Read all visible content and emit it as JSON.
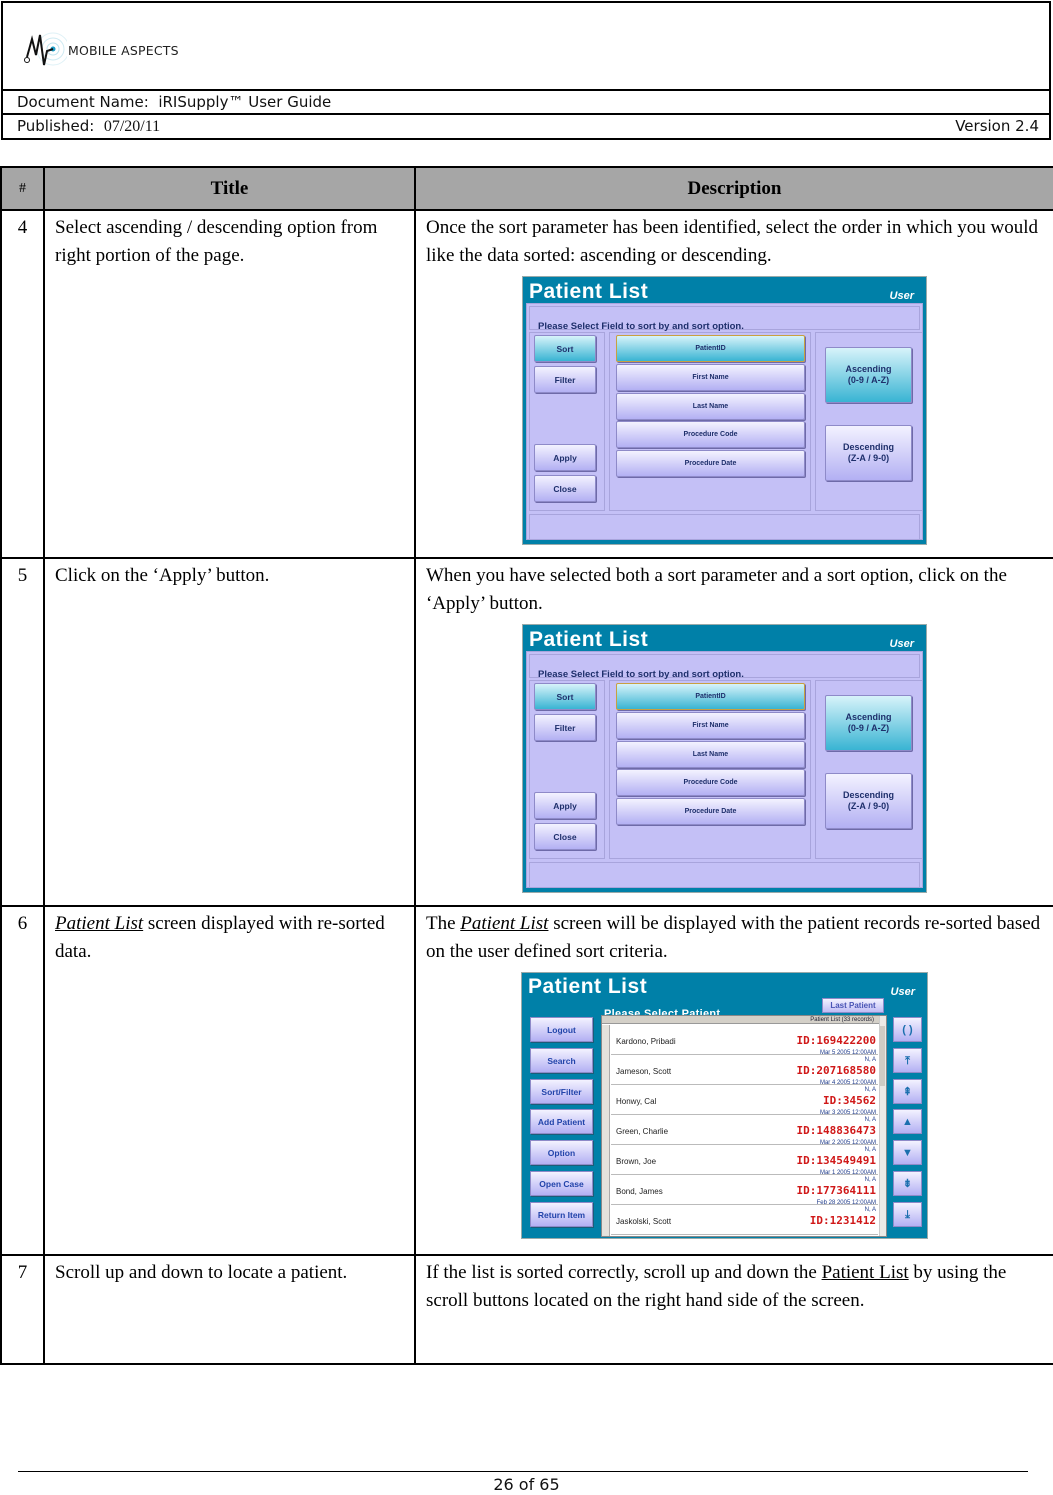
{
  "header": {
    "logo_text": "MOBILE ASPECTS",
    "doc_name_label": "Document Name:",
    "doc_name": "iRISupply™ User Guide",
    "published_label": "Published:",
    "published_date": "07/20/11",
    "version": "Version 2.4"
  },
  "table": {
    "headers": {
      "num": "#",
      "title": "Title",
      "description": "Description"
    },
    "rows": [
      {
        "num": "4",
        "title": "Select ascending / descending option from right portion of the page.",
        "description": "Once the sort parameter has been identified, select the order in which you would like the data sorted: ascending or descending."
      },
      {
        "num": "5",
        "title": "Click on the ‘Apply’ button.",
        "description": "When you have selected both a sort parameter and a sort option, click on the ‘Apply’ button."
      },
      {
        "num": "6",
        "title_link": "Patient List",
        "title_rest": " screen displayed with re-sorted data.",
        "description_pre": "The ",
        "description_link": "Patient List",
        "description_post": " screen will be displayed with the patient records re-sorted based on the user defined sort criteria."
      },
      {
        "num": "7",
        "title": "Scroll up and down to locate a patient.",
        "description_pre": "If the list is sorted correctly, scroll up and down the ",
        "description_link": "Patient List",
        "description_post": " by using the scroll buttons located on the right hand side of the screen."
      }
    ]
  },
  "sort_screen": {
    "title": "Patient List",
    "user": "User",
    "prompt": "Please Select Field to sort by and sort option.",
    "left_buttons": [
      "Sort",
      "Filter",
      "Apply",
      "Close"
    ],
    "fields": [
      "PatientID",
      "First Name",
      "Last Name",
      "Procedure Code",
      "Procedure Date"
    ],
    "selected_field": "PatientID",
    "ascending_label": "Ascending",
    "ascending_sub": "(0-9 / A-Z)",
    "descending_label": "Descending",
    "descending_sub": "(Z-A / 9-0)",
    "selected_order": "Ascending"
  },
  "patient_screen": {
    "title": "Patient List",
    "user": "User",
    "subtitle": "Please Select Patient",
    "last_patient_label": "Last Patient",
    "list_header": "Patient List (33 records)",
    "nav_buttons": [
      "Logout",
      "Search",
      "Sort/Filter",
      "Add Patient",
      "Option",
      "Open Case",
      "Return Item"
    ],
    "scroll_buttons": [
      "refresh",
      "scroll-top",
      "page-up",
      "up",
      "down",
      "page-down",
      "scroll-bottom"
    ],
    "patients": [
      {
        "name": "Kardono, Pribadi",
        "id": "ID:169422200",
        "date": "Mar  5 2005 12:00AM",
        "extra": "N, A"
      },
      {
        "name": "Jameson, Scott",
        "id": "ID:207168580",
        "date": "Mar  4 2005 12:00AM",
        "extra": "N, A"
      },
      {
        "name": "Honwy, Cal",
        "id": "ID:34562",
        "date": "Mar  3 2005 12:00AM",
        "extra": "N, A"
      },
      {
        "name": "Green, Charlie",
        "id": "ID:148836473",
        "date": "Mar  2 2005 12:00AM",
        "extra": "N, A"
      },
      {
        "name": "Brown, Joe",
        "id": "ID:134549491",
        "date": "Mar  1 2005 12:00AM",
        "extra": "N, A"
      },
      {
        "name": "Bond, James",
        "id": "ID:177364111",
        "date": "Feb 28 2005 12:00AM",
        "extra": "N, A"
      },
      {
        "name": "Jaskolski, Scott",
        "id": "ID:1231412",
        "date": "",
        "extra": ""
      }
    ]
  },
  "footer": {
    "page": "26 of 65"
  }
}
